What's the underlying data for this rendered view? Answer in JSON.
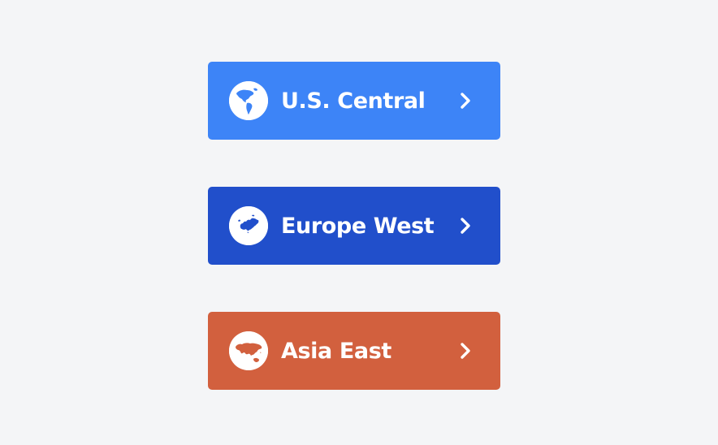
{
  "regions": [
    {
      "label": "U.S. Central",
      "color": "#3d84f7",
      "icon": "globe-americas-icon",
      "chevron_icon": "chevron-right-icon"
    },
    {
      "label": "Europe West",
      "color": "#214fcb",
      "icon": "globe-europe-icon",
      "chevron_icon": "chevron-right-icon"
    },
    {
      "label": "Asia East",
      "color": "#d2603e",
      "icon": "globe-asia-icon",
      "chevron_icon": "chevron-right-icon"
    }
  ]
}
